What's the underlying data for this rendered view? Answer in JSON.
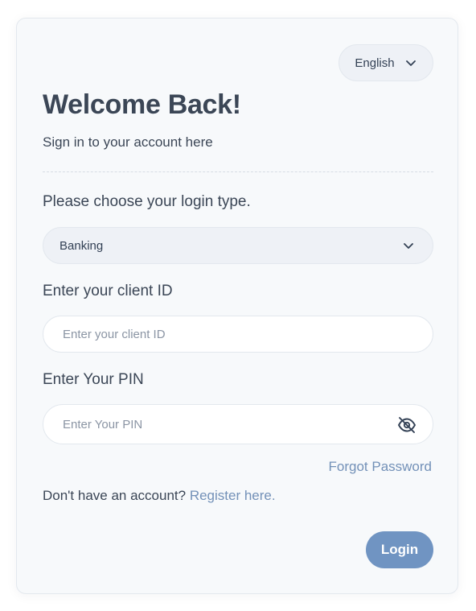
{
  "language": {
    "selected": "English",
    "icon": "chevron-down-icon"
  },
  "header": {
    "title": "Welcome Back!",
    "subtitle": "Sign in to your account here"
  },
  "login_type": {
    "label": "Please choose your login type.",
    "selected": "Banking",
    "icon": "chevron-down-icon"
  },
  "client_id": {
    "label": "Enter your client ID",
    "placeholder": "Enter your client ID",
    "value": ""
  },
  "pin": {
    "label": "Enter Your PIN",
    "placeholder": "Enter Your PIN",
    "value": "",
    "toggle_icon": "eye-off-icon"
  },
  "links": {
    "forgot_password": "Forgot Password",
    "register_prompt": "Don't have an account?",
    "register_link": "Register here."
  },
  "actions": {
    "login_label": "Login"
  },
  "colors": {
    "accent": "#7094c2",
    "link": "#7391b8",
    "card_background": "#f7f9fb",
    "text": "#3b4656"
  }
}
